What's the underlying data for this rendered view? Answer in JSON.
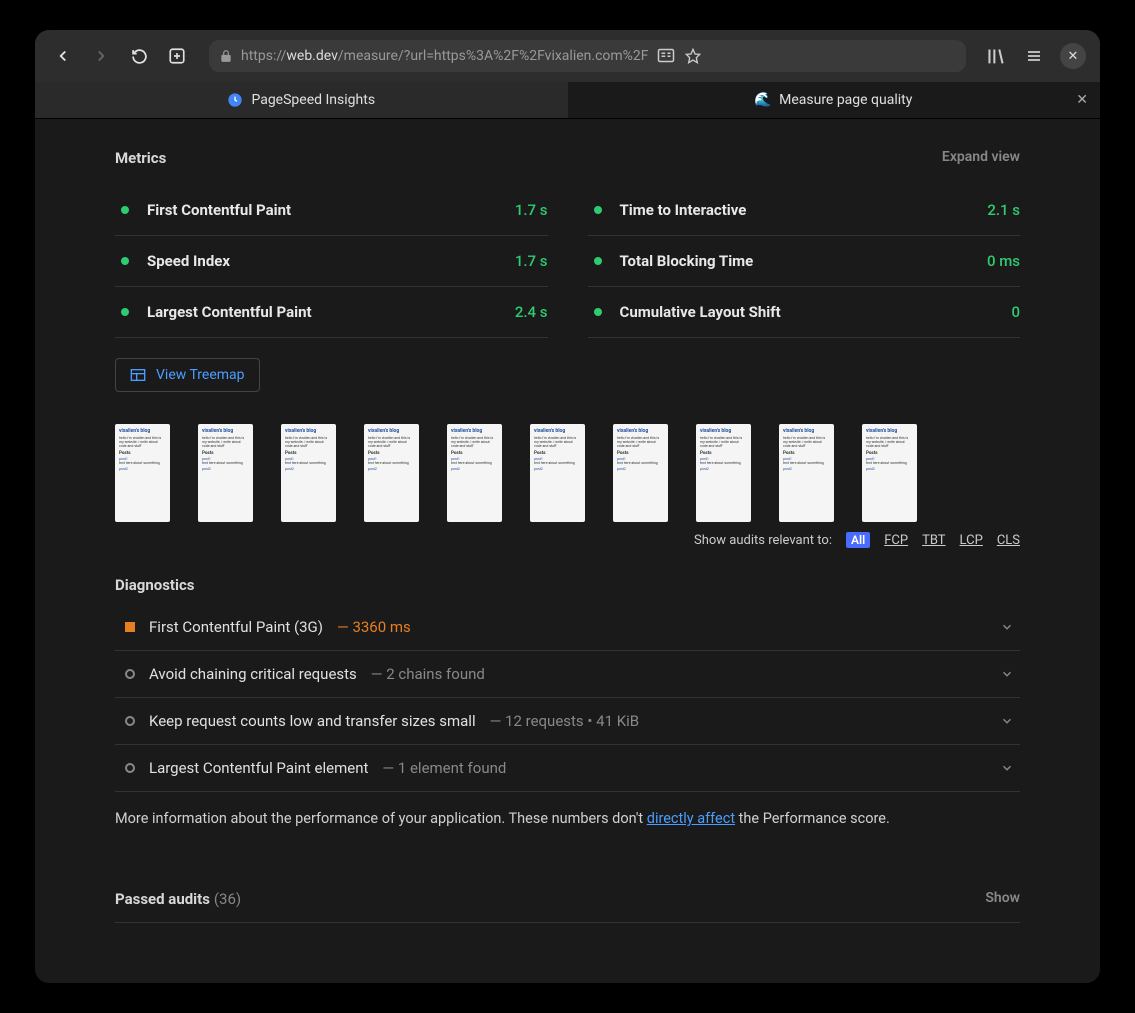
{
  "browser": {
    "url_prefix": "https://",
    "url_host": "web.dev",
    "url_path": "/measure/?url=https%3A%2F%2Fvixalien.com%2F",
    "tabs": [
      {
        "label": "PageSpeed Insights",
        "active": false
      },
      {
        "label": "Measure page quality",
        "active": true
      }
    ]
  },
  "metrics": {
    "title": "Metrics",
    "expand": "Expand view",
    "items": [
      {
        "label": "First Contentful Paint",
        "value": "1.7 s"
      },
      {
        "label": "Time to Interactive",
        "value": "2.1 s"
      },
      {
        "label": "Speed Index",
        "value": "1.7 s"
      },
      {
        "label": "Total Blocking Time",
        "value": "0 ms"
      },
      {
        "label": "Largest Contentful Paint",
        "value": "2.4 s"
      },
      {
        "label": "Cumulative Layout Shift",
        "value": "0"
      }
    ],
    "treemap_label": "View Treemap"
  },
  "filmstrip": {
    "thumb_title": "vixalien's blog",
    "thumb_sub": "Posts"
  },
  "audits_filter": {
    "label": "Show audits relevant to:",
    "all": "All",
    "options": [
      "FCP",
      "TBT",
      "LCP",
      "CLS"
    ]
  },
  "diagnostics": {
    "title": "Diagnostics",
    "items": [
      {
        "marker": "warn",
        "label": "First Contentful Paint (3G)",
        "detail": "— 3360 ms",
        "detail_style": "warn"
      },
      {
        "marker": "info",
        "label": "Avoid chaining critical requests",
        "detail": "— 2 chains found",
        "detail_style": ""
      },
      {
        "marker": "info",
        "label": "Keep request counts low and transfer sizes small",
        "detail": "— 12 requests • 41 KiB",
        "detail_style": ""
      },
      {
        "marker": "info",
        "label": "Largest Contentful Paint element",
        "detail": "— 1 element found",
        "detail_style": ""
      }
    ],
    "info_pre": "More information about the performance of your application. These numbers don't ",
    "info_link": "directly affect",
    "info_post": " the Performance score."
  },
  "passed": {
    "label": "Passed audits",
    "count": "(36)",
    "show": "Show"
  }
}
